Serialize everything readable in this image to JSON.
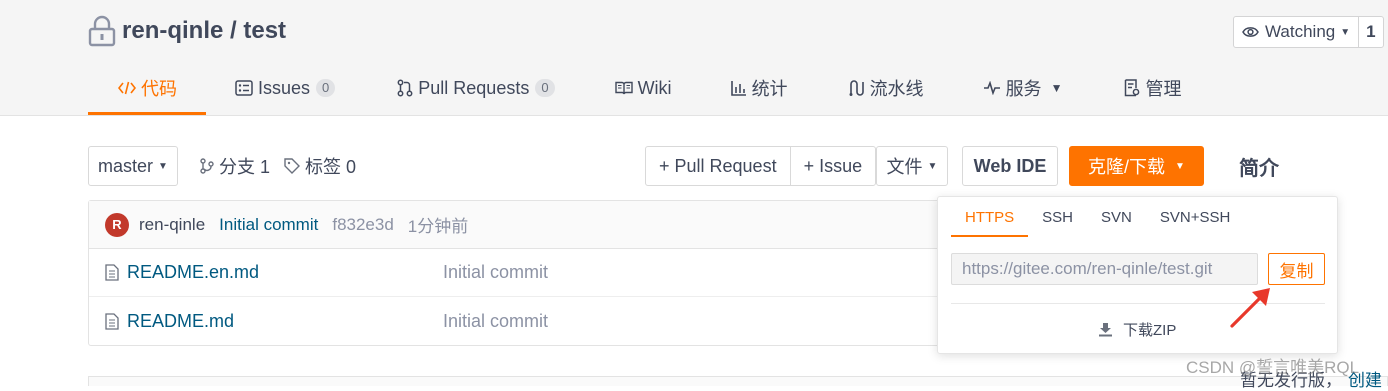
{
  "repo": {
    "owner": "ren-qinle",
    "separator": " / ",
    "name": "test",
    "title": "ren-qinle / test",
    "icon": "lock-icon"
  },
  "watch": {
    "label": "Watching",
    "count": "1",
    "icon": "eye-icon"
  },
  "tabs": [
    {
      "label": "代码",
      "icon": "code-icon",
      "active": true
    },
    {
      "label": "Issues",
      "badge": "0",
      "icon": "issue-icon"
    },
    {
      "label": "Pull Requests",
      "badge": "0",
      "icon": "pull-request-icon"
    },
    {
      "label": "Wiki",
      "icon": "book-icon"
    },
    {
      "label": "统计",
      "icon": "bar-chart-icon"
    },
    {
      "label": "流水线",
      "icon": "pipeline-icon"
    },
    {
      "label": "服务",
      "icon": "pulse-icon",
      "dropdown": true
    },
    {
      "label": "管理",
      "icon": "settings-doc-icon"
    }
  ],
  "toolbar": {
    "branch": "master",
    "branches_label": "分支 1",
    "tags_label": "标签 0",
    "pull_request": "+ Pull Request",
    "issue": "+ Issue",
    "file": "文件",
    "web_ide": "Web IDE",
    "clone": "克隆/下载",
    "intro": "简介"
  },
  "commit": {
    "avatar_letter": "R",
    "author": "ren-qinle",
    "message": "Initial commit",
    "sha": "f832e3d",
    "time": "1分钟前"
  },
  "files": [
    {
      "name": "README.en.md",
      "message": "Initial commit"
    },
    {
      "name": "README.md",
      "message": "Initial commit"
    }
  ],
  "clone_panel": {
    "protocols": [
      "HTTPS",
      "SSH",
      "SVN",
      "SVN+SSH"
    ],
    "active_protocol": "HTTPS",
    "url": "https://gitee.com/ren-qinle/test.git",
    "copy_label": "复制",
    "download_zip": "下载ZIP"
  },
  "watermark": "CSDN @誓言唯美RQL",
  "release": {
    "text": "暂无发行版，",
    "link": "创建"
  },
  "colors": {
    "accent": "#fe7300",
    "link": "#005980",
    "text": "#40485b",
    "muted": "#8c92a4",
    "annotation_arrow": "#e8382b"
  }
}
